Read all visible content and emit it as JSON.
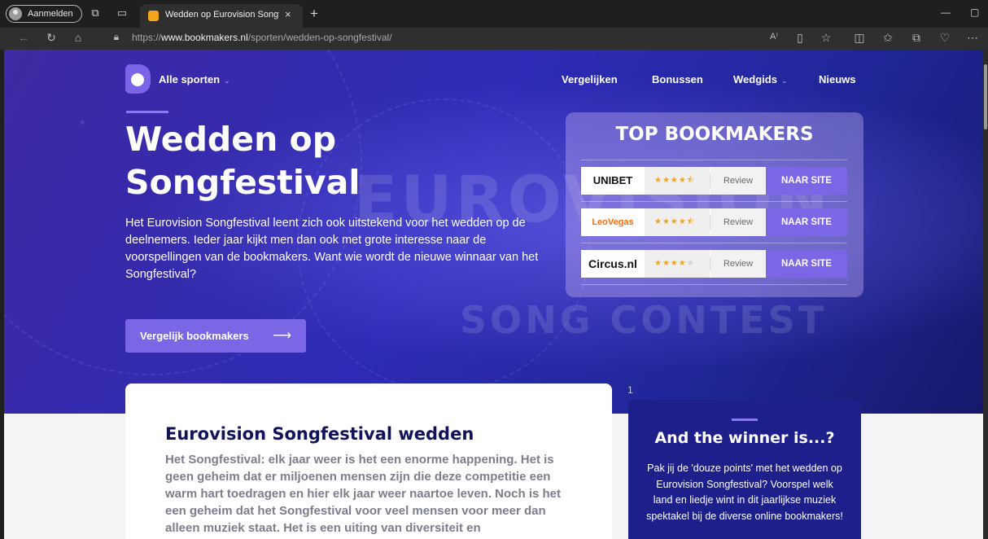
{
  "browser": {
    "profile_label": "Aanmelden",
    "tab_title": "Wedden op Eurovision Songfestival",
    "tab_close": "×",
    "new_tab": "+",
    "url_prefix": "https://",
    "url_domain": "www.bookmakers.nl",
    "url_path": "/sporten/wedden-op-songfestival/"
  },
  "site": {
    "nav": {
      "all_sports": "Alle sporten",
      "compare": "Vergelijken",
      "bonuses": "Bonussen",
      "betting_guide": "Wedgids",
      "news": "Nieuws"
    },
    "hero": {
      "title": "Wedden op Songfestival",
      "intro": "Het Eurovision Songfestival leent zich ook uitstekend voor het wedden op de deelnemers. Ieder jaar kijkt men dan ook met grote interesse naar de voorspellingen van de bookmakers. Want wie wordt de nieuwe winnaar van het Songfestival?",
      "cta_label": "Vergelijk bookmakers",
      "cta_arrow": "⟶",
      "bg_text_1": "EUROVISION",
      "bg_text_2": "SONG CONTEST"
    },
    "top_bookmakers": {
      "title": "TOP BOOKMAKERS",
      "rows": [
        {
          "name": "UNIBET",
          "rating": 4.5,
          "stars_on": "★★★★⯪",
          "stars_off": "",
          "review": "Review",
          "cta": "NAAR SITE",
          "color": "#0b0b0b"
        },
        {
          "name": "LeoVegas",
          "rating": 4.5,
          "stars_on": "★★★★⯪",
          "stars_off": "",
          "review": "Review",
          "cta": "NAAR SITE",
          "color": "#ff6b00"
        },
        {
          "name": "Circus.nl",
          "rating": 4,
          "stars_on": "★★★★",
          "stars_off": "★",
          "review": "Review",
          "cta": "NAAR SITE",
          "color": "#111111"
        }
      ]
    },
    "article": {
      "heading": "Eurovision Songfestival wedden",
      "body": "Het Songfestival: elk jaar weer is het een enorme happening. Het is geen geheim dat er miljoenen mensen zijn die deze competitie een warm hart toedragen en hier elk jaar weer naartoe leven. Noch is het een geheim dat het Songfestival voor veel mensen voor meer dan alleen muziek staat. Het is een uiting van diversiteit en"
    },
    "page_number": "1",
    "winner_box": {
      "title": "And the winner is...?",
      "text": "Pak jij de 'douze points' met het wedden op Eurovision Songfestival? Voorspel welk land en liedje wint in dit jaarlijkse muziek spektakel bij de diverse online bookmakers!"
    }
  },
  "colors": {
    "accent": "#7b66e6",
    "hero_dark": "#1f2696",
    "heading_navy": "#10125a",
    "star": "#f2a21f"
  }
}
